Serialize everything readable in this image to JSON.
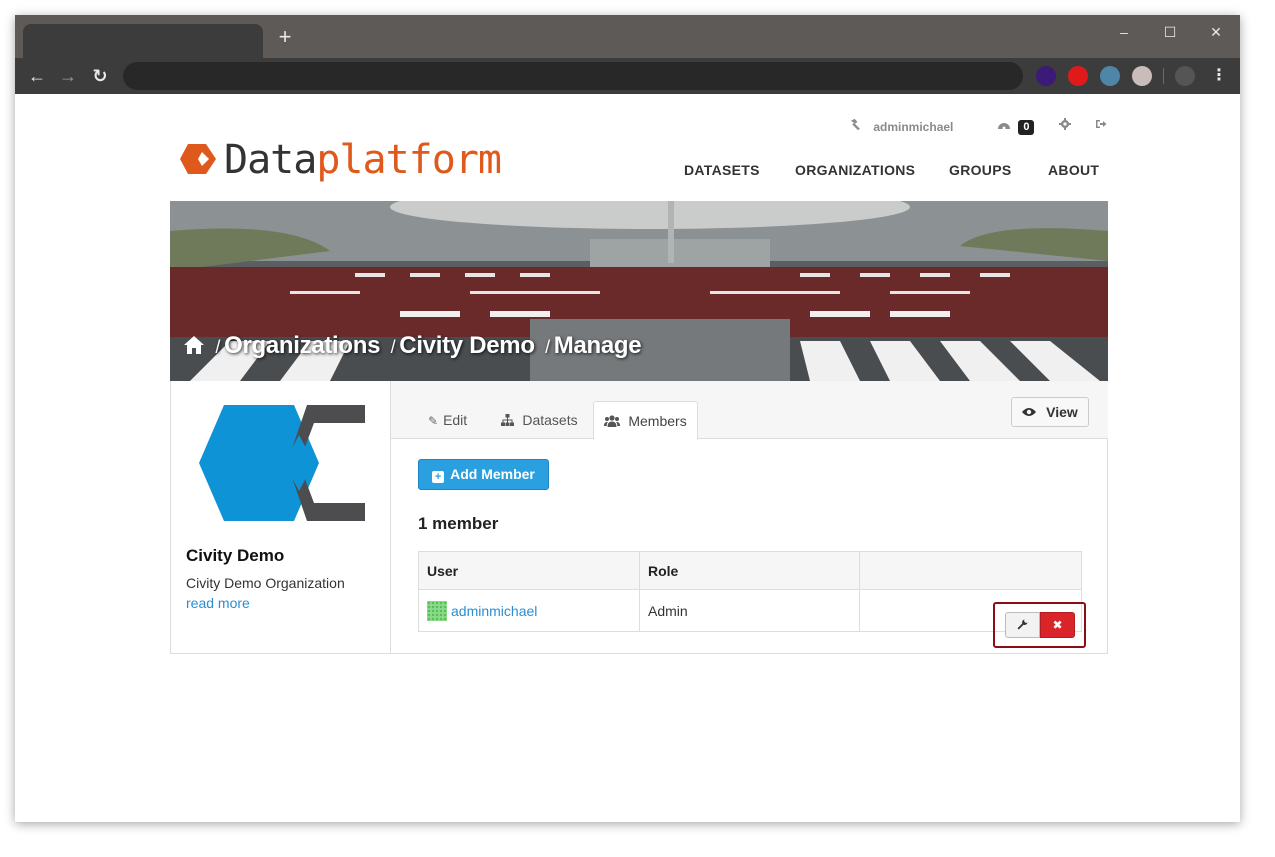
{
  "browser": {
    "new_tab_label": "+",
    "minimize_glyph": "–",
    "maximize_glyph": "☐",
    "close_glyph": "✕",
    "back_glyph": "←",
    "forward_glyph": "→",
    "reload_glyph": "↻",
    "menu_glyph": "⋮",
    "extension_colors": [
      "#3b1a78",
      "#e01a1a",
      "#4f86a8",
      "#c8bdb8",
      "#555555"
    ]
  },
  "account": {
    "username": "adminmichael",
    "notifications_count": "0"
  },
  "logo": {
    "part1": "Data",
    "part2": "platform",
    "accent_color": "#e0591c"
  },
  "nav": {
    "items": [
      "DATASETS",
      "ORGANIZATIONS",
      "GROUPS",
      "ABOUT"
    ]
  },
  "breadcrumb": {
    "items": [
      "Organizations",
      "Civity Demo",
      "Manage"
    ]
  },
  "organization": {
    "name": "Civity Demo",
    "description": "Civity Demo Organization",
    "read_more": "read more"
  },
  "tabs": {
    "edit": "Edit",
    "datasets": "Datasets",
    "members": "Members"
  },
  "view_button": "View",
  "add_member_button": "Add Member",
  "member_count": "1 member",
  "table": {
    "headers": [
      "User",
      "Role",
      ""
    ],
    "rows": [
      {
        "user": "adminmichael",
        "role": "Admin"
      }
    ]
  }
}
